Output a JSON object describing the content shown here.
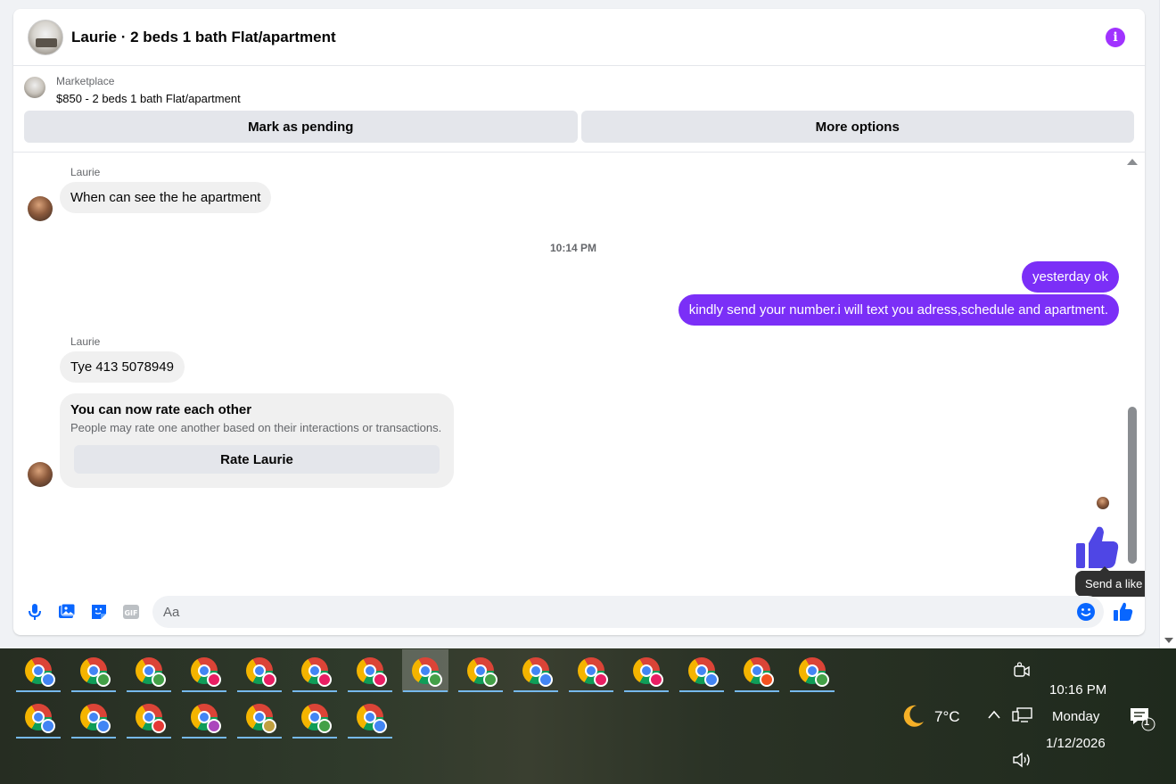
{
  "header": {
    "title": "Laurie · 2 beds 1 bath Flat/apartment"
  },
  "listing": {
    "source": "Marketplace",
    "description": "$850 - 2 beds 1 bath Flat/apartment",
    "mark_pending": "Mark as pending",
    "more_options": "More options"
  },
  "messages": {
    "sender1": "Laurie",
    "msg1": "When can see the he apartment",
    "timestamp": "10:14 PM",
    "out1": "yesterday ok",
    "out2": "kindly send your number.i will text you adress,schedule and apartment.",
    "sender2": "Laurie",
    "msg2": "Tye 413 5078949",
    "rate_title": "You can now rate each other",
    "rate_sub": "People may rate one another based on their interactions or transactions.",
    "rate_button": "Rate Laurie",
    "tooltip": "Send a like"
  },
  "composer": {
    "placeholder": "Aa"
  },
  "taskbar": {
    "row1_badges": [
      "#4285f4",
      "#43a047",
      "#43a047",
      "#e91e63",
      "#e91e63",
      "#e91e63",
      "#e91e63",
      "#43a047",
      "#43a047",
      "#4285f4",
      "#e91e63",
      "#e91e63",
      "#4285f4",
      "#f4511e",
      "#43a047"
    ],
    "row2_badges": [
      "#4285f4",
      "#4285f4",
      "#e53935",
      "#ab47bc",
      "#c0a040",
      "#43a047",
      "#4285f4"
    ],
    "active_index": 7,
    "weather_temp": "7°C",
    "time": "10:16 PM",
    "day": "Monday",
    "date": "1/12/2026",
    "notification_count": "1"
  },
  "colors": {
    "outgoing_bubble": "#7b2ff7",
    "accent_blue": "#0866ff",
    "info_purple": "#a033ff"
  }
}
